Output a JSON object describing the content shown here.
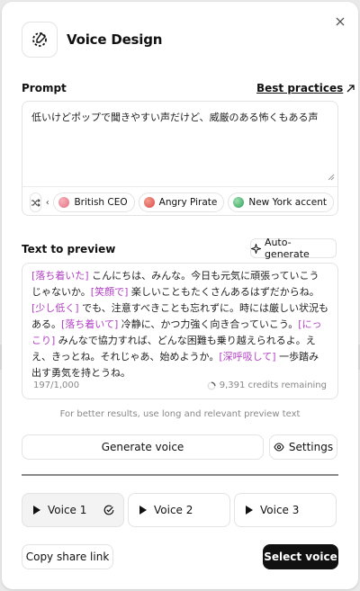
{
  "header": {
    "title": "Voice Design"
  },
  "prompt": {
    "label": "Prompt",
    "best_practices": "Best practices",
    "value": "低いけどポップで聞きやすい声だけど、威厳のある怖くもある声"
  },
  "chips": [
    {
      "label": "British CEO",
      "color": "#e4707f"
    },
    {
      "label": "Angry Pirate",
      "color": "#d94646"
    },
    {
      "label": "New York accent",
      "color": "#2e9e55"
    }
  ],
  "preview": {
    "label": "Text to preview",
    "auto_generate": "Auto-generate",
    "segments": [
      {
        "tag": "[落ち着いた]",
        "text": " こんにちは、みんな。今日も元気に頑張っていこうじゃないか。"
      },
      {
        "tag": "[笑顔で]",
        "text": " 楽しいこともたくさんあるはずだからね。"
      },
      {
        "tag": "[少し低く]",
        "text": " でも、注意すべきことも忘れずに。時には厳しい状況もある。"
      },
      {
        "tag": "[落ち着いて]",
        "text": " 冷静に、かつ力強く向き合っていこう。"
      },
      {
        "tag": "[にっこり]",
        "text": " みんなで協力すれば、どんな困難も乗り越えられるよ。ええ、きっとね。それじゃあ、始めようか。"
      },
      {
        "tag": "[深呼吸して]",
        "text": " 一歩踏み出す勇気を持とうね。"
      }
    ],
    "char_count": "197/1,000",
    "credits": "9,391 credits remaining",
    "hint": "For better results, use long and relevant preview text"
  },
  "actions": {
    "generate": "Generate voice",
    "settings": "Settings"
  },
  "voices": [
    {
      "label": "Voice 1",
      "selected": true
    },
    {
      "label": "Voice 2",
      "selected": false
    },
    {
      "label": "Voice 3",
      "selected": false
    }
  ],
  "footer": {
    "copy_share": "Copy share link",
    "select_voice": "Select voice"
  },
  "colors": {
    "accent_tag": "#b23fc4",
    "primary_button": "#111111"
  }
}
